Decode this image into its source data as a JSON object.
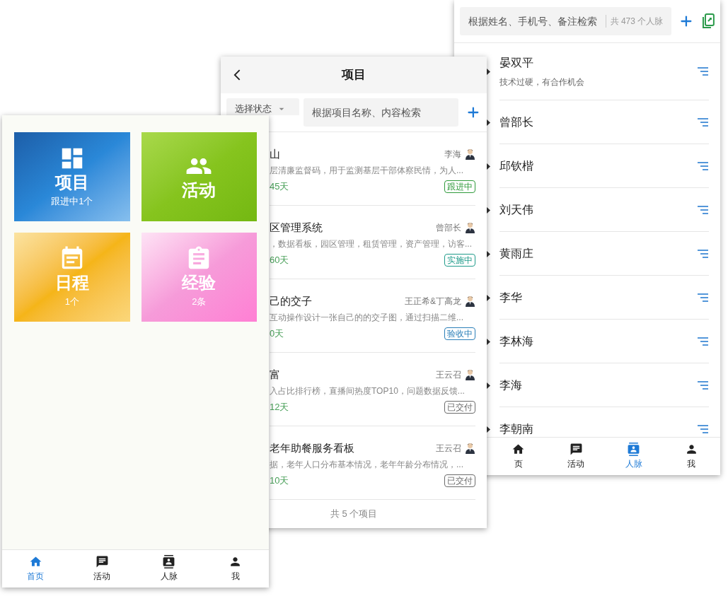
{
  "contacts_screen": {
    "search": {
      "placeholder": "根据姓名、手机号、备注检索"
    },
    "count": "共 473 个人脉",
    "contacts": [
      {
        "name": "晏双平",
        "note": "技术过硬，有合作机会"
      },
      {
        "name": "曾部长"
      },
      {
        "name": "邱钦楷"
      },
      {
        "name": "刘天伟"
      },
      {
        "name": "黄雨庄"
      },
      {
        "name": "李华"
      },
      {
        "name": "李林海"
      },
      {
        "name": "李海"
      },
      {
        "name": "李朝南"
      }
    ],
    "tab_bar": [
      {
        "label": "页",
        "kind": "home",
        "selected": false
      },
      {
        "label": "活动",
        "kind": "activity",
        "selected": false
      },
      {
        "label": "人脉",
        "kind": "contacts",
        "selected": true
      },
      {
        "label": "我",
        "kind": "me",
        "selected": false
      }
    ]
  },
  "projects_screen": {
    "title": "项目",
    "status_filter": "选择状态",
    "search": {
      "placeholder": "根据项目名称、内容检索"
    },
    "projects": [
      {
        "title": "山",
        "owner": "李海",
        "description": "层清廉监督码，用于监测基层干部体察民情，为人...",
        "duration": "45天",
        "status": "跟进中",
        "color": "#2e9a3a"
      },
      {
        "title": "区管理系统",
        "owner": "曾部长",
        "description": "，数据看板，园区管理，租赁管理，资产管理，访客...",
        "duration": "60天",
        "status": "实施中",
        "color": "#1f9b8a"
      },
      {
        "title": "己的交子",
        "owner": "王正希&丁高龙",
        "description": "互动操作设计一张自己的的交子图，通过扫描二维...",
        "duration": "0天",
        "status": "验收中",
        "color": "#2b7fb8"
      },
      {
        "title": "富",
        "owner": "王云召",
        "description": "入占比排行榜，直播间热度TOP10，问题数据反馈...",
        "duration": "12天",
        "status": "已交付",
        "color": "#6b6b6b"
      },
      {
        "title": "老年助餐服务看板",
        "owner": "王云召",
        "description": "据，老年人口分布基本情况，老年年龄分布情况，...",
        "duration": "10天",
        "status": "已交付",
        "color": "#6b6b6b"
      }
    ],
    "footer": "共 5 个项目"
  },
  "home_screen": {
    "tiles": [
      {
        "kind": "projects",
        "title": "项目",
        "subtitle": "跟进中1个"
      },
      {
        "kind": "activities",
        "title": "活动"
      },
      {
        "kind": "schedule",
        "title": "日程",
        "subtitle": "1个"
      },
      {
        "kind": "experience",
        "title": "经验",
        "subtitle": "2条"
      }
    ],
    "tab_bar": [
      {
        "label": "首页",
        "kind": "home",
        "selected": true
      },
      {
        "label": "活动",
        "kind": "activity",
        "selected": false
      },
      {
        "label": "人脉",
        "kind": "contacts",
        "selected": false
      },
      {
        "label": "我",
        "kind": "me",
        "selected": false
      }
    ]
  }
}
